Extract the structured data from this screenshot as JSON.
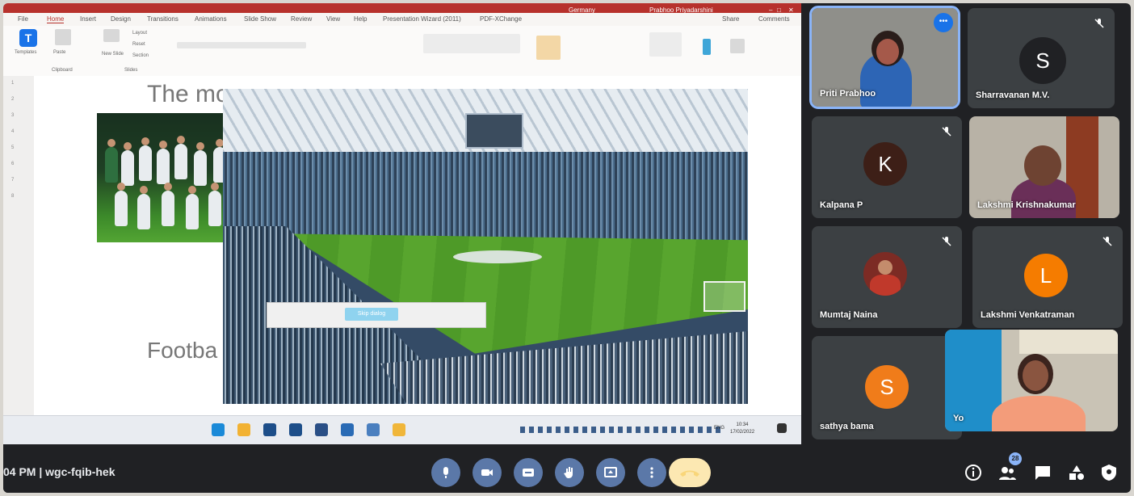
{
  "ppt": {
    "title_text": "Germany",
    "user_name": "Prabhoo Priyadarshini",
    "menu": [
      "File",
      "Home",
      "Insert",
      "Design",
      "Transitions",
      "Animations",
      "Slide Show",
      "Review",
      "View",
      "Help",
      "Presentation Wizard (2011)",
      "PDF-XChange"
    ],
    "active_menu": "Home",
    "share_label": "Share",
    "comments_label": "Comments",
    "ribbon_templates": "Templates",
    "ribbon_paste": "Paste",
    "ribbon_new_slide": "New Slide",
    "ribbon_layout": "Layout",
    "ribbon_reset": "Reset",
    "ribbon_section": "Section",
    "ribbon_clipboard": "Clipboard",
    "ribbon_slides": "Slides",
    "slide_title_partial": "The mo",
    "slide_footer_partial": "Footba",
    "dialog_button": "Skip dialog",
    "clock_time": "10:34",
    "clock_date": "17/02/2022",
    "lang": "ENG"
  },
  "participants": [
    {
      "name": "Priti Prabhoo",
      "type": "video",
      "speaking": true
    },
    {
      "name": "Sharravanan M.V.",
      "type": "avatar",
      "initial": "S",
      "color": "#202124",
      "muted": true
    },
    {
      "name": "Kalpana P",
      "type": "avatar",
      "initial": "K",
      "color": "#3d1f17",
      "muted": true
    },
    {
      "name": "Lakshmi Krishnakumar",
      "type": "video",
      "muted": false
    },
    {
      "name": "Mumtaj Naina",
      "type": "photo",
      "muted": true
    },
    {
      "name": "Lakshmi Venkatraman",
      "type": "avatar",
      "initial": "L",
      "color": "#f57c00",
      "muted": true
    },
    {
      "name": "sathya bama",
      "type": "avatar",
      "initial": "S",
      "color": "#f07c1a",
      "muted": false
    },
    {
      "name": "Yo",
      "type": "video",
      "muted": false
    }
  ],
  "bottom": {
    "meeting_info": "04 PM  |  wgc-fqib-hek",
    "participant_count": "28"
  },
  "colors": {
    "meet_bg": "#202124",
    "control_blue": "#5b78a8",
    "present_yellow": "#fce8b2",
    "speaking_outline": "#8ab4f8"
  },
  "icons": {
    "controls": [
      "mic-icon",
      "camera-icon",
      "captions-icon",
      "raise-hand-icon",
      "present-screen-icon",
      "more-options-icon",
      "end-call-icon"
    ],
    "right": [
      "info-icon",
      "people-icon",
      "chat-icon",
      "activities-icon",
      "host-controls-icon"
    ]
  }
}
